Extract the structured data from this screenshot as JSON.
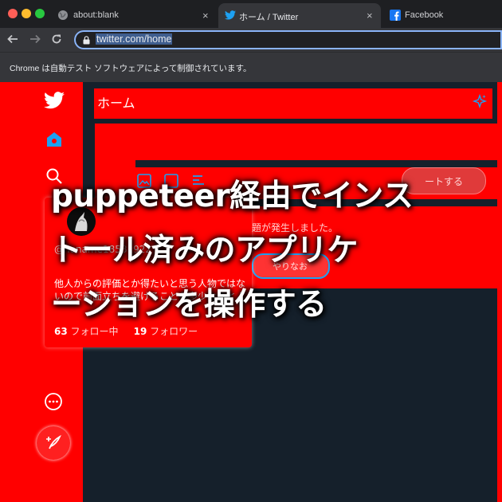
{
  "browser": {
    "tabs": [
      {
        "title": "about:blank",
        "close": "×"
      },
      {
        "title": "ホーム / Twitter",
        "close": "×"
      },
      {
        "title": "Facebook"
      }
    ],
    "url": "twitter.com/home",
    "infobar": "Chrome は自動テスト ソフトウェアによって制御されています。",
    "traffic_colors": [
      "#ff5f57",
      "#febc2e",
      "#28c840"
    ]
  },
  "twitter": {
    "header_title": "ホーム",
    "tweet_button": "ートする",
    "error_text": "題が発生しました。",
    "retry_button": "やりなお",
    "profile": {
      "handle": "@noname18581922",
      "bio": "他人からの評価とか得たいと思う人物ではないので前面立ちを避けることも多少なことよ",
      "following_count": "63",
      "following_label": "フォロー中",
      "followers_count": "19",
      "followers_label": "フォロワー"
    },
    "accent": "#1da1f2"
  },
  "overlay": {
    "lines": [
      "puppeteer経由でインス",
      "トール済みのアプリケ",
      "ーションを操作する"
    ]
  }
}
